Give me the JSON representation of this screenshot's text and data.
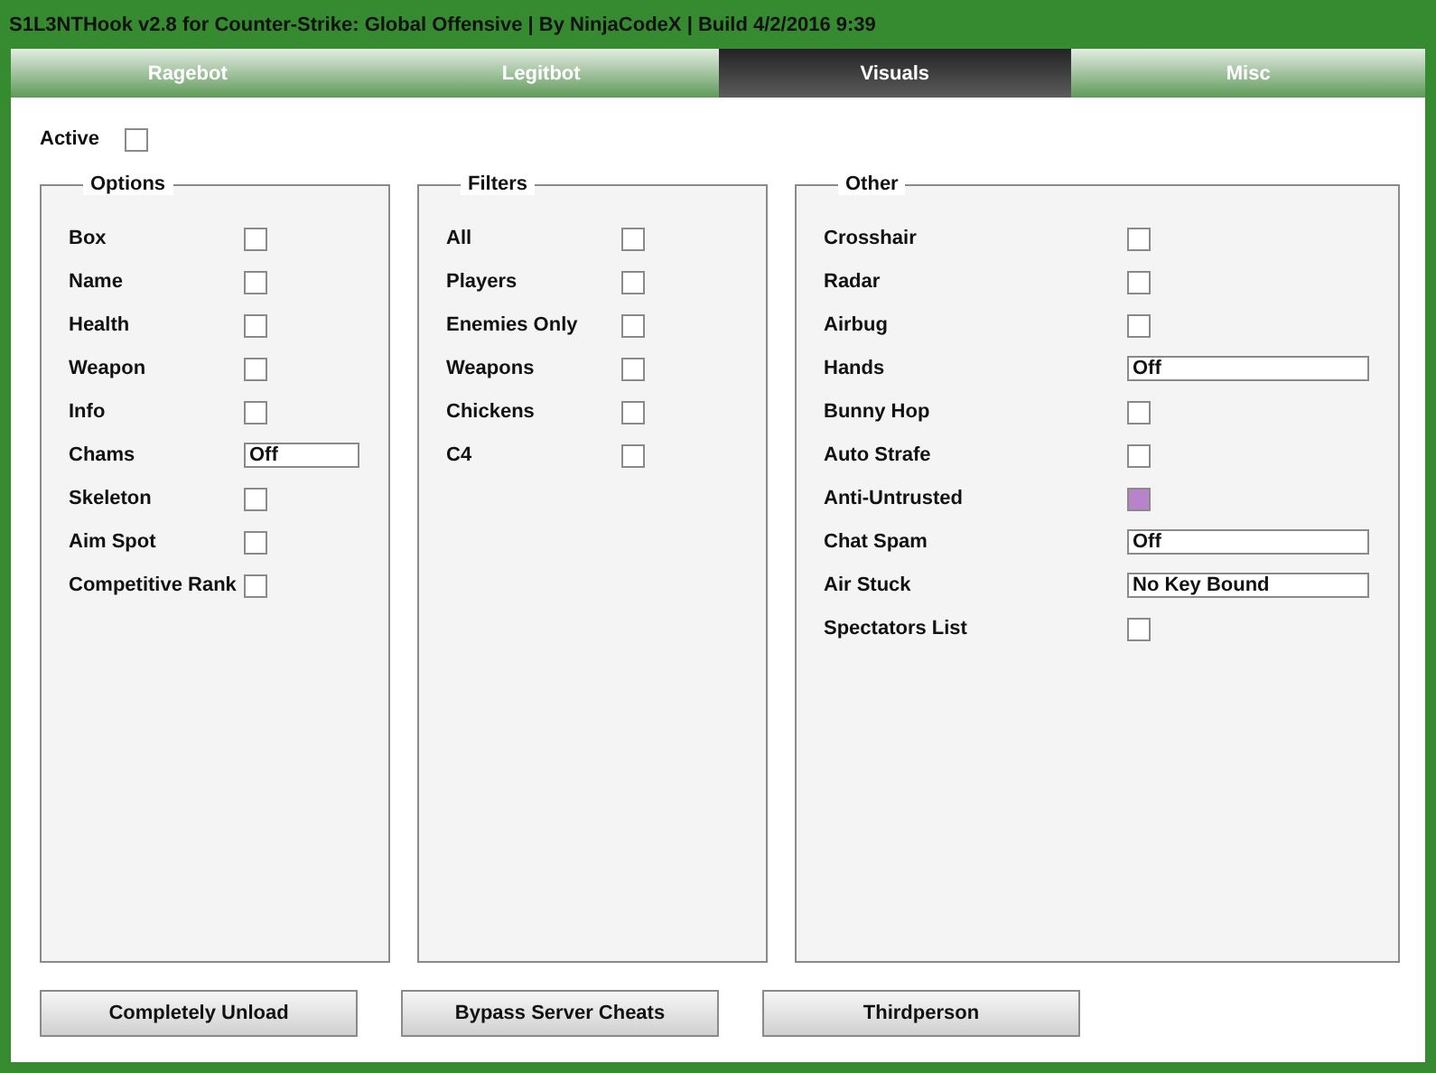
{
  "window": {
    "title": "S1L3NTHook v2.8 for Counter-Strike: Global Offensive | By NinjaCodeX | Build 4/2/2016 9:39"
  },
  "tabs": [
    {
      "label": "Ragebot",
      "selected": false
    },
    {
      "label": "Legitbot",
      "selected": false
    },
    {
      "label": "Visuals",
      "selected": true
    },
    {
      "label": "Misc",
      "selected": false
    }
  ],
  "active": {
    "label": "Active",
    "checked": false
  },
  "groups": [
    {
      "title": "Options",
      "items": [
        {
          "kind": "checkbox",
          "label": "Box",
          "checked": false
        },
        {
          "kind": "checkbox",
          "label": "Name",
          "checked": false
        },
        {
          "kind": "checkbox",
          "label": "Health",
          "checked": false
        },
        {
          "kind": "checkbox",
          "label": "Weapon",
          "checked": false
        },
        {
          "kind": "checkbox",
          "label": "Info",
          "checked": false
        },
        {
          "kind": "field",
          "label": "Chams",
          "value": "Off"
        },
        {
          "kind": "checkbox",
          "label": "Skeleton",
          "checked": false
        },
        {
          "kind": "checkbox",
          "label": "Aim Spot",
          "checked": false
        },
        {
          "kind": "checkbox",
          "label": "Competitive Rank",
          "checked": false
        }
      ]
    },
    {
      "title": "Filters",
      "items": [
        {
          "kind": "checkbox",
          "label": "All",
          "checked": false
        },
        {
          "kind": "checkbox",
          "label": "Players",
          "checked": false
        },
        {
          "kind": "checkbox",
          "label": "Enemies Only",
          "checked": false
        },
        {
          "kind": "checkbox",
          "label": "Weapons",
          "checked": false
        },
        {
          "kind": "checkbox",
          "label": "Chickens",
          "checked": false
        },
        {
          "kind": "checkbox",
          "label": "C4",
          "checked": false
        }
      ]
    },
    {
      "title": "Other",
      "items": [
        {
          "kind": "checkbox",
          "label": "Crosshair",
          "checked": false
        },
        {
          "kind": "checkbox",
          "label": "Radar",
          "checked": false
        },
        {
          "kind": "checkbox",
          "label": "Airbug",
          "checked": false
        },
        {
          "kind": "field",
          "label": "Hands",
          "value": "Off"
        },
        {
          "kind": "checkbox",
          "label": "Bunny Hop",
          "checked": false
        },
        {
          "kind": "checkbox",
          "label": "Auto Strafe",
          "checked": false
        },
        {
          "kind": "checkbox",
          "label": "Anti-Untrusted",
          "checked": true
        },
        {
          "kind": "field",
          "label": "Chat Spam",
          "value": "Off"
        },
        {
          "kind": "field",
          "label": "Air Stuck",
          "value": "No Key Bound"
        },
        {
          "kind": "checkbox",
          "label": "Spectators List",
          "checked": false
        }
      ]
    }
  ],
  "buttons": [
    "Completely Unload",
    "Bypass Server Cheats",
    "Thirdperson"
  ]
}
